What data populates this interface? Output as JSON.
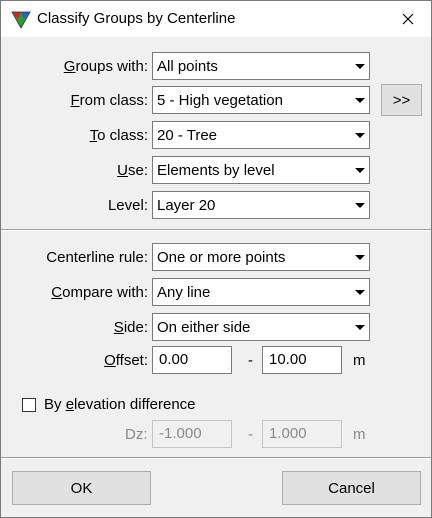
{
  "window": {
    "title": "Classify Groups by Centerline",
    "close_glyph": "✕"
  },
  "fields": {
    "groups_with": {
      "label_u": "G",
      "label_rest": "roups with:",
      "value": "All points"
    },
    "from_class": {
      "label_u": "F",
      "label_rest": "rom class:",
      "value": "5 - High vegetation"
    },
    "to_class": {
      "label_u": "T",
      "label_rest": "o class:",
      "value": "20 - Tree"
    },
    "use": {
      "label_u": "U",
      "label_rest": "se:",
      "value": "Elements by level"
    },
    "level": {
      "label": "Level:",
      "value": "Layer 20"
    },
    "centerline_rule": {
      "label": "Centerline rule:",
      "value": "One or more points"
    },
    "compare_with": {
      "label_u": "C",
      "label_rest": "ompare with:",
      "value": "Any line"
    },
    "side": {
      "label_u": "S",
      "label_rest": "ide:",
      "value": "On either side"
    },
    "offset": {
      "label_u": "O",
      "label_rest": "ffset:",
      "from": "0.00",
      "dash": "-",
      "to": "10.00",
      "unit": "m"
    }
  },
  "more_button": ">>",
  "elevation": {
    "checkbox_pre": "By ",
    "checkbox_u": "e",
    "checkbox_rest": "levation difference",
    "checked": false,
    "dz_label": "Dz:",
    "from": "-1.000",
    "dash": "-",
    "to": "1.000",
    "unit": "m"
  },
  "buttons": {
    "ok": "OK",
    "cancel": "Cancel"
  },
  "colors": {
    "accent_red": "#d9261c",
    "accent_green": "#2e9a3a",
    "accent_blue": "#1f5fd0"
  }
}
